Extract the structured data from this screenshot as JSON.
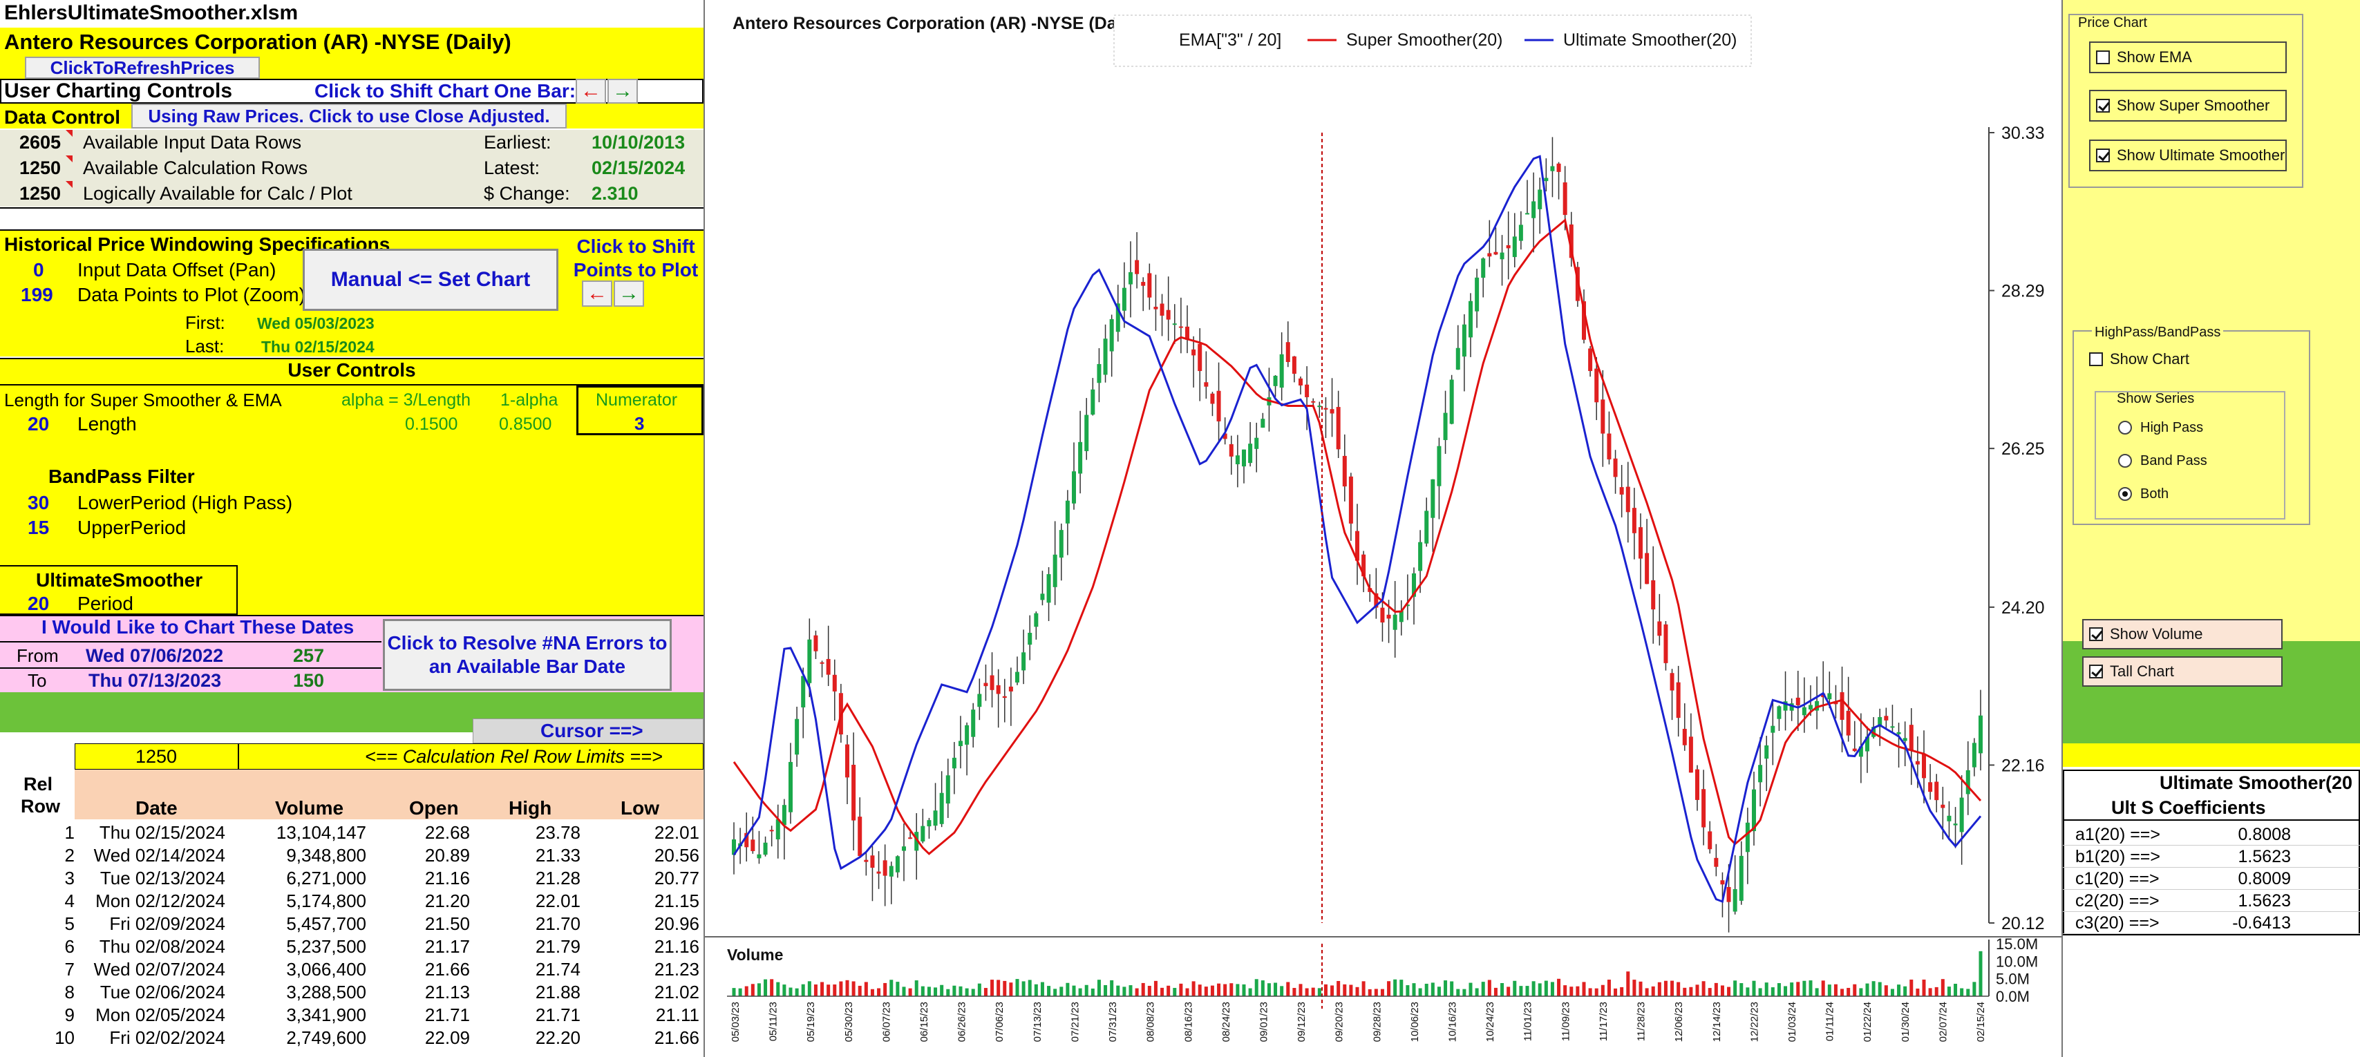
{
  "file_title": "EhlersUltimateSmoother.xlsm",
  "ticker_title": "Antero Resources Corporation (AR) -NYSE  (Daily)",
  "refresh_button": "ClickToRefreshPrices",
  "user_charting_controls": "User Charting Controls",
  "shift_one_bar": "Click to Shift Chart One Bar:",
  "data_control": "Data Control",
  "raw_prices_button": "Using Raw Prices. Click to use Close Adjusted.",
  "stats": [
    {
      "num": "2605",
      "label": "Available Input Data Rows",
      "key": "Earliest:",
      "val": "10/10/2013"
    },
    {
      "num": "1250",
      "label": "Available Calculation Rows",
      "key": "Latest:",
      "val": "02/15/2024"
    },
    {
      "num": "1250",
      "label": "Logically Available for Calc / Plot",
      "key": "$ Change:",
      "val": "2.310"
    }
  ],
  "windowing": {
    "title": "Historical Price Windowing Specifications",
    "offset_val": "0",
    "offset_label": "Input Data Offset (Pan)",
    "points_val": "199",
    "points_label": "Data Points to Plot (Zoom)",
    "set_chart_button": "Manual <= Set Chart",
    "shift_points_label": "Click to Shift Points to Plot",
    "first_label": "First:",
    "first_val": "Wed 05/03/2023",
    "last_label": "Last:",
    "last_val": "Thu 02/15/2024"
  },
  "user_controls": {
    "title": "User Controls",
    "length_label": "Length for Super Smoother & EMA",
    "alpha_label": "alpha = 3/Length",
    "one_minus_alpha_label": "1-alpha",
    "numerator_label": "Numerator",
    "length_val": "20",
    "length_name": "Length",
    "alpha_val": "0.1500",
    "one_minus_alpha_val": "0.8500",
    "numerator_val": "3"
  },
  "bandpass": {
    "title": "BandPass Filter",
    "lower_val": "30",
    "lower_label": "LowerPeriod (High Pass)",
    "upper_val": "15",
    "upper_label": "UpperPeriod"
  },
  "ultimate": {
    "title": "UltimateSmoother",
    "period_val": "20",
    "period_label": "Period"
  },
  "chart_dates": {
    "title": "I Would Like to Chart These Dates",
    "from_label": "From",
    "from_date": "Wed 07/06/2022",
    "from_num": "257",
    "to_label": "To",
    "to_date": "Thu 07/13/2023",
    "to_num": "150",
    "resolve_button": "Click to Resolve #NA Errors to an Available Bar Date"
  },
  "cursor_label": "Cursor ==>",
  "calc_limit_val": "1250",
  "calc_limit_label": "<== Calculation Rel Row Limits ==>",
  "table": {
    "headers": {
      "rel_a": "Rel",
      "rel_b": "Row",
      "date": "Date",
      "volume": "Volume",
      "open": "Open",
      "high": "High",
      "low": "Low"
    },
    "rows": [
      [
        "1",
        "Thu 02/15/2024",
        "13,104,147",
        "22.68",
        "23.78",
        "22.01"
      ],
      [
        "2",
        "Wed 02/14/2024",
        "9,348,800",
        "20.89",
        "21.33",
        "20.56"
      ],
      [
        "3",
        "Tue 02/13/2024",
        "6,271,000",
        "21.16",
        "21.28",
        "20.77"
      ],
      [
        "4",
        "Mon 02/12/2024",
        "5,174,800",
        "21.20",
        "22.01",
        "21.15"
      ],
      [
        "5",
        "Fri 02/09/2024",
        "5,457,700",
        "21.50",
        "21.70",
        "20.96"
      ],
      [
        "6",
        "Thu 02/08/2024",
        "5,237,500",
        "21.17",
        "21.79",
        "21.16"
      ],
      [
        "7",
        "Wed 02/07/2024",
        "3,066,400",
        "21.66",
        "21.74",
        "21.23"
      ],
      [
        "8",
        "Tue 02/06/2024",
        "3,288,500",
        "21.13",
        "21.88",
        "21.02"
      ],
      [
        "9",
        "Mon 02/05/2024",
        "3,341,900",
        "21.71",
        "21.71",
        "21.11"
      ],
      [
        "10",
        "Fri 02/02/2024",
        "2,749,600",
        "22.09",
        "22.20",
        "21.66"
      ]
    ]
  },
  "chart": {
    "title": "Antero Resources Corporation (AR) -NYSE  (Daily)",
    "legend_ema": "EMA[\"3\" / 20]",
    "legend_ss": "Super Smoother(20)",
    "legend_us": "Ultimate Smoother(20)",
    "volume_label": "Volume",
    "colors": {
      "up": "#1aa84a",
      "down": "#e02020",
      "ss": "#e01010",
      "us": "#1a22d0"
    }
  },
  "chart_data": {
    "type": "line",
    "title": "Antero Resources Corporation (AR) -NYSE  (Daily)",
    "y_ticks": [
      "30.33",
      "28.29",
      "26.25",
      "24.20",
      "22.16",
      "20.12"
    ],
    "ylim": [
      20.12,
      30.33
    ],
    "vol_ticks": [
      "15.0M",
      "10.0M",
      "5.0M",
      "0.0M"
    ],
    "x_ticks": [
      "05/03/23",
      "05/11/23",
      "05/19/23",
      "05/30/23",
      "06/07/23",
      "06/15/23",
      "06/26/23",
      "07/06/23",
      "07/13/23",
      "07/21/23",
      "07/31/23",
      "08/08/23",
      "08/16/23",
      "08/24/23",
      "09/01/23",
      "09/12/23",
      "09/20/23",
      "09/28/23",
      "10/06/23",
      "10/16/23",
      "10/24/23",
      "11/01/23",
      "11/09/23",
      "11/17/23",
      "11/28/23",
      "12/06/23",
      "12/14/23",
      "12/22/23",
      "01/03/24",
      "01/11/24",
      "01/22/24",
      "01/30/24",
      "02/07/24",
      "02/15/24"
    ],
    "close_anchors": [
      21.2,
      21.0,
      21.6,
      23.8,
      23.2,
      21.0,
      20.7,
      21.2,
      21.5,
      22.4,
      23.2,
      23.0,
      24.0,
      25.0,
      26.5,
      27.8,
      28.6,
      28.0,
      27.8,
      27.0,
      26.1,
      26.4,
      27.5,
      26.9,
      26.7,
      24.8,
      24.0,
      24.2,
      25.8,
      27.5,
      28.7,
      28.8,
      29.4,
      30.0,
      27.8,
      26.2,
      25.3,
      24.0,
      22.6,
      21.2,
      20.3,
      22.0,
      23.0,
      22.9,
      23.1,
      22.3,
      22.8,
      22.5,
      21.8,
      21.4,
      22.8
    ],
    "super_smoother_anchors": [
      22.2,
      21.7,
      21.3,
      21.6,
      23.0,
      22.4,
      21.5,
      21.0,
      21.3,
      21.9,
      22.4,
      22.9,
      23.6,
      24.5,
      25.7,
      27.0,
      27.7,
      27.6,
      27.3,
      26.9,
      26.8,
      26.8,
      25.2,
      24.4,
      24.1,
      24.6,
      25.8,
      27.3,
      28.4,
      28.9,
      29.2,
      27.5,
      26.5,
      25.5,
      24.4,
      22.5,
      21.1,
      21.4,
      22.5,
      22.9,
      23.0,
      22.6,
      22.4,
      22.3,
      22.1,
      21.7
    ],
    "ultimate_smoother_anchors": [
      21.0,
      21.5,
      23.8,
      23.1,
      20.8,
      21.0,
      21.4,
      22.4,
      23.2,
      23.1,
      24.0,
      25.1,
      26.6,
      28.0,
      28.6,
      27.9,
      27.7,
      26.8,
      26.0,
      26.5,
      27.4,
      26.8,
      26.9,
      24.6,
      24.0,
      24.3,
      26.0,
      27.6,
      28.6,
      28.9,
      29.6,
      30.1,
      27.6,
      26.1,
      25.2,
      23.9,
      22.5,
      21.0,
      20.3,
      21.9,
      23.0,
      22.9,
      23.1,
      22.2,
      22.7,
      22.5,
      21.6,
      21.1,
      21.5
    ]
  },
  "right_panel": {
    "price_chart_title": "Price Chart",
    "show_ema": "Show EMA",
    "show_ema_on": false,
    "show_ss": "Show Super Smoother",
    "show_ss_on": true,
    "show_us": "Show Ultimate Smoother",
    "show_us_on": true,
    "hp_title": "HighPass/BandPass",
    "show_chart": "Show Chart",
    "show_chart_on": false,
    "show_series_title": "Show Series",
    "high_pass": "High Pass",
    "band_pass": "Band Pass",
    "both": "Both",
    "selected": "Both",
    "show_volume": "Show Volume",
    "show_volume_on": true,
    "tall_chart": "Tall Chart",
    "tall_chart_on": true,
    "coef_title": "Ultimate Smoother(20",
    "coef_subtitle": "Ult S Coefficients",
    "coefficients": [
      {
        "name": "a1(20) ==>",
        "val": "0.8008"
      },
      {
        "name": "b1(20) ==>",
        "val": "1.5623"
      },
      {
        "name": "c1(20) ==>",
        "val": "0.8009"
      },
      {
        "name": "c2(20) ==>",
        "val": "1.5623"
      },
      {
        "name": "c3(20) ==>",
        "val": "-0.6413"
      }
    ]
  }
}
